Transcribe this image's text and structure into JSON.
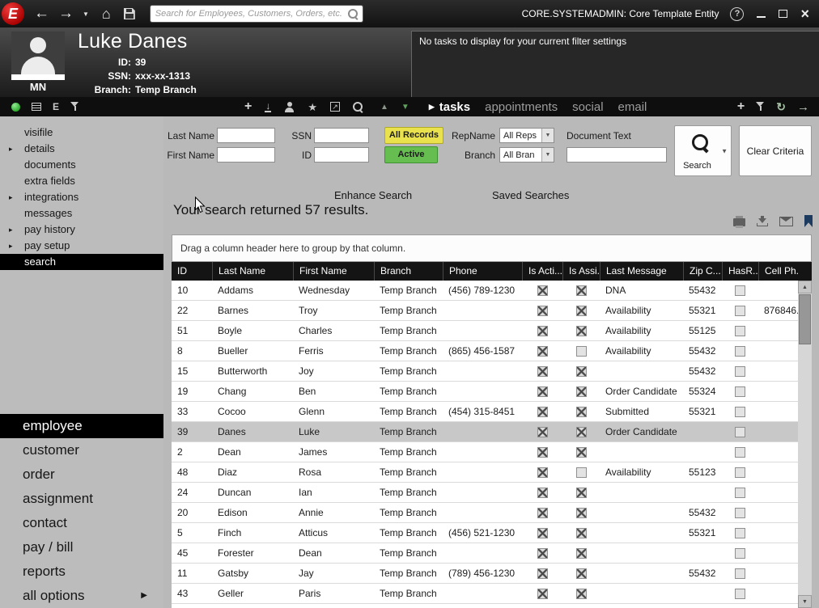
{
  "titlebar": {
    "logo": "E",
    "search_placeholder": "Search for Employees, Customers, Orders, etc.",
    "search_value": "",
    "app_title": "CORE.SYSTEMADMIN: Core Template Entity"
  },
  "header": {
    "name": "Luke Danes",
    "state": "MN",
    "fields": [
      {
        "label": "ID:",
        "value": "39"
      },
      {
        "label": "SSN:",
        "value": "xxx-xx-1313"
      },
      {
        "label": "Branch:",
        "value": "Temp Branch"
      }
    ],
    "tasks_message": "No tasks to display for your current filter settings"
  },
  "toolbar": {
    "tabs": [
      {
        "label": "tasks",
        "active": true
      },
      {
        "label": "appointments",
        "active": false
      },
      {
        "label": "social",
        "active": false
      },
      {
        "label": "email",
        "active": false
      }
    ]
  },
  "sidebar": {
    "nav": [
      {
        "label": "visifile",
        "bullet": false,
        "selected": false
      },
      {
        "label": "details",
        "bullet": true,
        "selected": false
      },
      {
        "label": "documents",
        "bullet": false,
        "selected": false
      },
      {
        "label": "extra fields",
        "bullet": false,
        "selected": false
      },
      {
        "label": "integrations",
        "bullet": true,
        "selected": false
      },
      {
        "label": "messages",
        "bullet": false,
        "selected": false
      },
      {
        "label": "pay history",
        "bullet": true,
        "selected": false
      },
      {
        "label": "pay setup",
        "bullet": true,
        "selected": false
      },
      {
        "label": "search",
        "bullet": false,
        "selected": true
      }
    ],
    "sections": [
      {
        "label": "employee",
        "selected": true,
        "arrow": false
      },
      {
        "label": "customer",
        "selected": false,
        "arrow": false
      },
      {
        "label": "order",
        "selected": false,
        "arrow": false
      },
      {
        "label": "assignment",
        "selected": false,
        "arrow": false
      },
      {
        "label": "contact",
        "selected": false,
        "arrow": false
      },
      {
        "label": "pay / bill",
        "selected": false,
        "arrow": false
      },
      {
        "label": "reports",
        "selected": false,
        "arrow": false
      },
      {
        "label": "all options",
        "selected": false,
        "arrow": true
      }
    ]
  },
  "search_form": {
    "last_name_label": "Last Name",
    "first_name_label": "First Name",
    "ssn_label": "SSN",
    "id_label": "ID",
    "last_name_value": "",
    "first_name_value": "",
    "ssn_value": "",
    "id_value": "",
    "all_records_button": "All Records",
    "active_button": "Active",
    "repname_label": "RepName",
    "repname_value": "All Reps",
    "branch_label": "Branch",
    "branch_value": "All Bran",
    "document_text_label": "Document Text",
    "document_text_value": "",
    "search_button": "Search",
    "clear_button": "Clear Criteria",
    "colors": {
      "all_records": "#e9e24c",
      "active": "#66bd50"
    }
  },
  "results": {
    "enhance_search_label": "Enhance Search",
    "saved_searches_label": "Saved Searches",
    "summary": "Your search returned 57 results.",
    "group_hint": "Drag a column header here to group by that column.",
    "columns": [
      "ID",
      "Last Name",
      "First Name",
      "Branch",
      "Phone",
      "Is Acti...",
      "Is Assi...",
      "Last Message",
      "Zip C...",
      "HasR...",
      "Cell Ph..."
    ],
    "rows": [
      {
        "id": "10",
        "last": "Addams",
        "first": "Wednesday",
        "branch": "Temp Branch",
        "phone": "(456) 789-1230",
        "active": true,
        "assigned": true,
        "msg": "DNA",
        "zip": "55432",
        "hasr": false,
        "cell": "",
        "selected": false
      },
      {
        "id": "22",
        "last": "Barnes",
        "first": "Troy",
        "branch": "Temp Branch",
        "phone": "",
        "active": true,
        "assigned": true,
        "msg": "Availability",
        "zip": "55321",
        "hasr": false,
        "cell": "876846...",
        "selected": false
      },
      {
        "id": "51",
        "last": "Boyle",
        "first": "Charles",
        "branch": "Temp Branch",
        "phone": "",
        "active": true,
        "assigned": true,
        "msg": "Availability",
        "zip": "55125",
        "hasr": false,
        "cell": "",
        "selected": false
      },
      {
        "id": "8",
        "last": "Bueller",
        "first": "Ferris",
        "branch": "Temp Branch",
        "phone": "(865) 456-1587",
        "active": true,
        "assigned": false,
        "msg": "Availability",
        "zip": "55432",
        "hasr": false,
        "cell": "",
        "selected": false
      },
      {
        "id": "15",
        "last": "Butterworth",
        "first": "Joy",
        "branch": "Temp Branch",
        "phone": "",
        "active": true,
        "assigned": true,
        "msg": "",
        "zip": "55432",
        "hasr": false,
        "cell": "",
        "selected": false
      },
      {
        "id": "19",
        "last": "Chang",
        "first": "Ben",
        "branch": "Temp Branch",
        "phone": "",
        "active": true,
        "assigned": true,
        "msg": "Order Candidate",
        "zip": "55324",
        "hasr": false,
        "cell": "",
        "selected": false
      },
      {
        "id": "33",
        "last": "Cocoo",
        "first": "Glenn",
        "branch": "Temp Branch",
        "phone": "(454) 315-8451",
        "active": true,
        "assigned": true,
        "msg": "Submitted",
        "zip": "55321",
        "hasr": false,
        "cell": "",
        "selected": false
      },
      {
        "id": "39",
        "last": "Danes",
        "first": "Luke",
        "branch": "Temp Branch",
        "phone": "",
        "active": true,
        "assigned": true,
        "msg": "Order Candidate",
        "zip": "",
        "hasr": false,
        "cell": "",
        "selected": true
      },
      {
        "id": "2",
        "last": "Dean",
        "first": "James",
        "branch": "Temp Branch",
        "phone": "",
        "active": true,
        "assigned": true,
        "msg": "",
        "zip": "",
        "hasr": false,
        "cell": "",
        "selected": false
      },
      {
        "id": "48",
        "last": "Diaz",
        "first": "Rosa",
        "branch": "Temp Branch",
        "phone": "",
        "active": true,
        "assigned": false,
        "msg": "Availability",
        "zip": "55123",
        "hasr": false,
        "cell": "",
        "selected": false
      },
      {
        "id": "24",
        "last": "Duncan",
        "first": "Ian",
        "branch": "Temp Branch",
        "phone": "",
        "active": true,
        "assigned": true,
        "msg": "",
        "zip": "",
        "hasr": false,
        "cell": "",
        "selected": false
      },
      {
        "id": "20",
        "last": "Edison",
        "first": "Annie",
        "branch": "Temp Branch",
        "phone": "",
        "active": true,
        "assigned": true,
        "msg": "",
        "zip": "55432",
        "hasr": false,
        "cell": "",
        "selected": false
      },
      {
        "id": "5",
        "last": "Finch",
        "first": "Atticus",
        "branch": "Temp Branch",
        "phone": "(456) 521-1230",
        "active": true,
        "assigned": true,
        "msg": "",
        "zip": "55321",
        "hasr": false,
        "cell": "",
        "selected": false
      },
      {
        "id": "45",
        "last": "Forester",
        "first": "Dean",
        "branch": "Temp Branch",
        "phone": "",
        "active": true,
        "assigned": true,
        "msg": "",
        "zip": "",
        "hasr": false,
        "cell": "",
        "selected": false
      },
      {
        "id": "11",
        "last": "Gatsby",
        "first": "Jay",
        "branch": "Temp Branch",
        "phone": "(789) 456-1230",
        "active": true,
        "assigned": true,
        "msg": "",
        "zip": "55432",
        "hasr": false,
        "cell": "",
        "selected": false
      },
      {
        "id": "43",
        "last": "Geller",
        "first": "Paris",
        "branch": "Temp Branch",
        "phone": "",
        "active": true,
        "assigned": true,
        "msg": "",
        "zip": "",
        "hasr": false,
        "cell": "",
        "selected": false
      }
    ]
  },
  "icons": {
    "back": "←",
    "forward": "→",
    "nav_dropdown": "▼",
    "home": "⌂",
    "help": "?",
    "close": "×",
    "plus": "+",
    "import": "↓",
    "export": "↗",
    "star": "★",
    "up": "▲",
    "down": "▼",
    "refresh": "↻",
    "goto": "→",
    "entity": "E",
    "tab_marker": "▶",
    "bullet": "▸",
    "section_arrow": "▶",
    "select_arrow": "▼",
    "search_dropdown": "▼",
    "scroll_up": "▲",
    "scroll_down": "▼"
  }
}
